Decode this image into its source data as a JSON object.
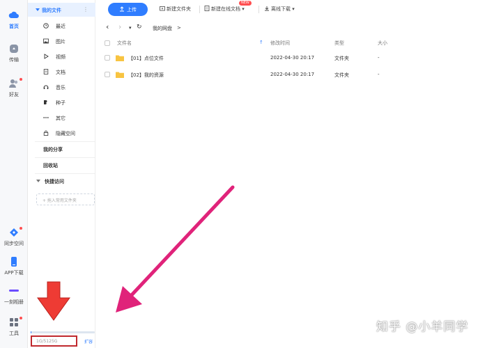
{
  "rail": {
    "items": [
      {
        "label": "首页",
        "icon": "cloud-icon",
        "active": true
      },
      {
        "label": "传输",
        "icon": "transfer-icon"
      },
      {
        "label": "好友",
        "icon": "friends-icon"
      },
      {
        "label": "同步空间",
        "icon": "sync-space-icon"
      },
      {
        "label": "APP下载",
        "icon": "phone-icon"
      },
      {
        "label": "一刻相册",
        "icon": "album-icon"
      },
      {
        "label": "工具",
        "icon": "tools-icon"
      }
    ]
  },
  "nav": {
    "my_files": "我的文件",
    "more_glyph": "⋮",
    "items": [
      {
        "label": "最近",
        "icon": "clock-icon"
      },
      {
        "label": "图片",
        "icon": "image-icon"
      },
      {
        "label": "视频",
        "icon": "video-icon"
      },
      {
        "label": "文档",
        "icon": "document-icon"
      },
      {
        "label": "音乐",
        "icon": "music-icon"
      },
      {
        "label": "种子",
        "icon": "torrent-icon"
      },
      {
        "label": "其它",
        "icon": "more-dots-icon"
      },
      {
        "label": "隐藏空间",
        "icon": "lock-icon"
      }
    ],
    "my_share": "我的分享",
    "recycle_bin": "回收站",
    "quick_access": "快捷访问",
    "add_folder_placeholder": "+ 拖入常用文件夹"
  },
  "storage": {
    "text": "1G/5125G",
    "used_fraction": 0.0002,
    "expand_label": "扩容"
  },
  "toolbar": {
    "upload": "上传",
    "new_folder": "新建文件夹",
    "new_online_doc": "新建在线文档",
    "new_badge": "NEW",
    "offline_download": "离线下载"
  },
  "breadcrumb": {
    "back": "‹",
    "forward": "›",
    "dropdown": "▾",
    "refresh": "↻",
    "path": "我的网盘",
    "sep": ">"
  },
  "table": {
    "headers": {
      "name": "文件名",
      "sort_glyph": "↑",
      "modified": "修改时间",
      "type": "类型",
      "size": "大小"
    },
    "rows": [
      {
        "name": "【01】点位文件",
        "modified": "2022-04-30 20:17",
        "type": "文件夹",
        "size": "-"
      },
      {
        "name": "【02】我的资源",
        "modified": "2022-04-30 20:17",
        "type": "文件夹",
        "size": "-"
      }
    ]
  },
  "watermark": "知乎 @小羊同学",
  "colors": {
    "accent": "#2f7dff",
    "annotation_arrow": "#e0237a",
    "red_arrow": "#ee3b34",
    "highlight_box": "#c0282d",
    "folder": "#f8c441"
  }
}
